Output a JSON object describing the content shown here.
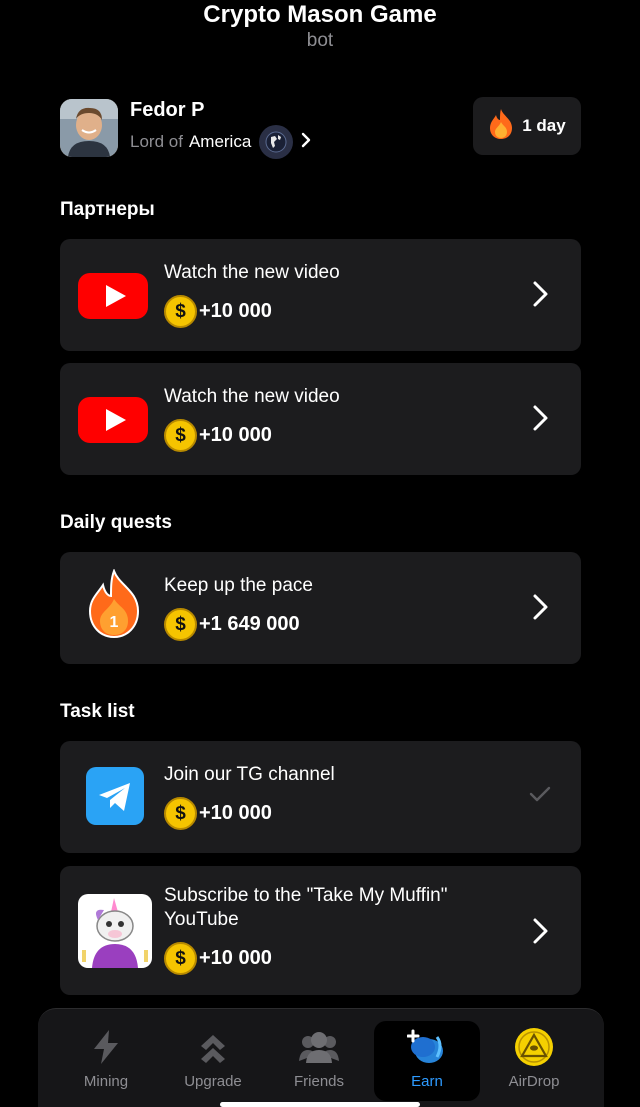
{
  "header": {
    "title": "Crypto Mason Game",
    "subtitle": "bot"
  },
  "profile": {
    "name": "Fedor P",
    "lord_prefix": "Lord of",
    "region": "America"
  },
  "streak": {
    "label": "1 day"
  },
  "sections": {
    "partners": "Партнеры",
    "daily": "Daily quests",
    "tasks": "Task list"
  },
  "partner_cards": [
    {
      "title": "Watch the new video",
      "reward": "+10 000",
      "icon": "youtube-icon"
    },
    {
      "title": "Watch the new video",
      "reward": "+10 000",
      "icon": "youtube-icon"
    }
  ],
  "daily_cards": [
    {
      "title": "Keep up the pace",
      "reward": "+1 649 000",
      "icon": "flame-icon",
      "badge": "1"
    }
  ],
  "task_cards": [
    {
      "title": "Join our TG channel",
      "reward": "+10 000",
      "icon": "telegram-icon",
      "status": "done"
    },
    {
      "title": "Subscribe to the \"Take My Muffin\" YouTube",
      "reward": "+10 000",
      "icon": "unicorn-avatar-icon"
    }
  ],
  "nav": {
    "mining": "Mining",
    "upgrade": "Upgrade",
    "friends": "Friends",
    "earn": "Earn",
    "airdrop": "AirDrop"
  },
  "colors": {
    "background": "#000000",
    "card": "#1c1c1e",
    "accent": "#2e9bff",
    "coin": "#f5c400",
    "youtube": "#ff0000"
  }
}
